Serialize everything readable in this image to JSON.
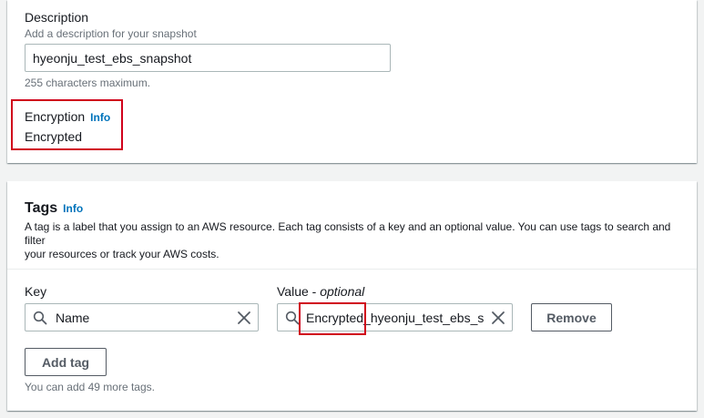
{
  "description": {
    "label": "Description",
    "hint": "Add a description for your snapshot",
    "value": "hyeonju_test_ebs_snapshot",
    "constraint": "255 characters maximum."
  },
  "encryption": {
    "label": "Encryption",
    "info": "Info",
    "value": "Encrypted"
  },
  "tags": {
    "title": "Tags",
    "info": "Info",
    "description": "A tag is a label that you assign to an AWS resource. Each tag consists of a key and an optional value. You can use tags to search and filter",
    "description_line2": "your resources or track your AWS costs.",
    "key_label": "Key",
    "value_label": "Value - ",
    "value_label_optional": "optional",
    "rows": [
      {
        "key": "Name",
        "value": "Encrypted_hyeonju_test_ebs_sna"
      }
    ],
    "remove_label": "Remove",
    "add_tag_label": "Add tag",
    "remaining": "You can add 49 more tags."
  },
  "colors": {
    "accent_link": "#0073bb",
    "highlight": "#d0021b"
  }
}
